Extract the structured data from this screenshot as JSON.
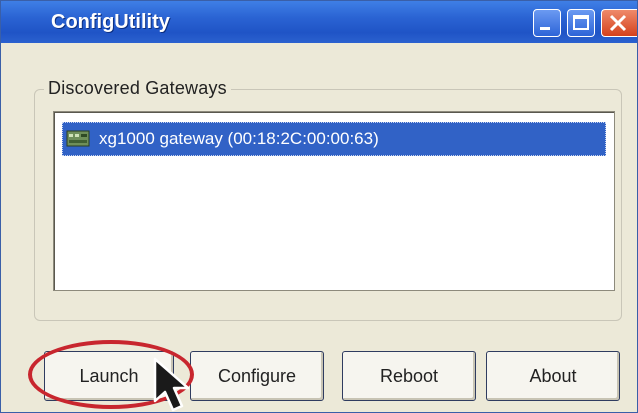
{
  "window": {
    "title": "ConfigUtility",
    "controls": {
      "minimize_icon": "minimize-icon",
      "maximize_icon": "maximize-icon",
      "close_icon": "close-icon"
    }
  },
  "gateways": {
    "group_label": "Discovered Gateways",
    "items": [
      {
        "label": "xg1000 gateway (00:18:2C:00:00:63)",
        "icon": "gateway-icon",
        "selected": true
      }
    ]
  },
  "buttons": {
    "launch": "Launch",
    "configure": "Configure",
    "reboot": "Reboot",
    "about": "About"
  },
  "annotations": {
    "highlight_color": "#c8262e",
    "highlighted_button": "launch",
    "cursor_icon": "mouse-pointer-icon"
  },
  "colors": {
    "titlebar": "#2a63d3",
    "selection": "#3162c6",
    "dialog_background": "#ece9d8"
  }
}
